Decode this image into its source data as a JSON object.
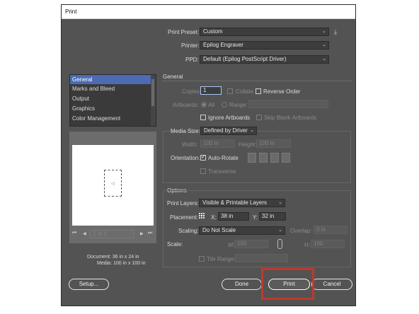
{
  "window": {
    "title": "Print"
  },
  "general": {
    "print_preset_label": "Print Preset:",
    "print_preset_value": "Custom",
    "printer_label": "Printer:",
    "printer_value": "Epilog Engraver",
    "ppd_label": "PPD:",
    "ppd_value": "Default (Epilog PostScript Driver)"
  },
  "sidebar": {
    "items": [
      {
        "label": "General",
        "selected": true
      },
      {
        "label": "Marks and Bleed"
      },
      {
        "label": "Output"
      },
      {
        "label": "Graphics"
      },
      {
        "label": "Color Management"
      }
    ]
  },
  "section_general": {
    "heading": "General",
    "copies_label": "Copies:",
    "copies_value": "1",
    "collate_label": "Collate",
    "reverse_order_label": "Reverse Order",
    "artboards_label": "Artboards:",
    "all_label": "All",
    "range_label": "Range:",
    "ignore_artboards_label": "Ignore Artboards",
    "skip_blank_label": "Skip Blank Artboards",
    "media_size_label": "Media Size:",
    "media_size_value": "Defined by Driver",
    "width_label": "Width:",
    "width_value": "100 in",
    "height_label": "Height:",
    "height_value": "100 in",
    "orientation_label": "Orientation:",
    "auto_rotate_label": "Auto-Rotate",
    "transverse_label": "Transverse"
  },
  "section_options": {
    "heading": "Options",
    "print_layers_label": "Print Layers:",
    "print_layers_value": "Visible & Printable Layers",
    "placement_label": "Placement:",
    "x_label": "X:",
    "x_value": "38 in",
    "y_label": "Y:",
    "y_value": "32 in",
    "scaling_label": "Scaling:",
    "scaling_value": "Do Not Scale",
    "overlap_label": "Overlap:",
    "overlap_value": "0 in",
    "scale_label": "Scale:",
    "w_label": "W:",
    "w_value": "100",
    "h_label": "H:",
    "h_value": "100",
    "tile_range_label": "Tile Range:"
  },
  "preview": {
    "page_counter": "1 of 1",
    "document_info": "Document: 36 in x 24 in",
    "media_info": "Media: 100 in x 100 in"
  },
  "buttons": {
    "setup": "Setup...",
    "done": "Done",
    "print": "Print",
    "cancel": "Cancel"
  },
  "icons": {
    "chevron": "⌄",
    "save_preset": "⤓",
    "first_page": "⏮",
    "prev_page": "◀",
    "next_page": "▶",
    "last_page": "⏭",
    "link": "🔗"
  },
  "colors": {
    "dialog_bg": "#535353",
    "highlight": "#c0392b",
    "selection": "#4b6cb4"
  }
}
